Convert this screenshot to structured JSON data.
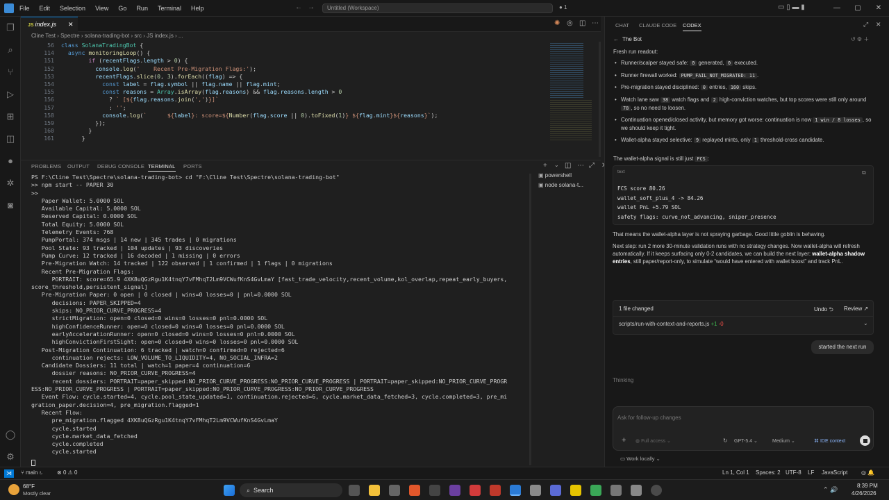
{
  "menu": [
    "File",
    "Edit",
    "Selection",
    "View",
    "Go",
    "Run",
    "Terminal",
    "Help"
  ],
  "workspace_title": "Untitled (Workspace)",
  "editor": {
    "tab": "index.js",
    "breadcrumb": "Cline Test › Spectre › solana-trading-bot › src › JS index.js › ...",
    "lines": [
      {
        "n": "56",
        "html": "<span class=\"kw\">class</span> <span class=\"cls\">SolanaTradingBot</span> {"
      },
      {
        "n": "114",
        "html": "  <span class=\"kw\">async</span> <span class=\"fn\">monitoringLoop</span>() {"
      },
      {
        "n": "151",
        "html": "        <span class=\"kw2\">if</span> (<span class=\"var\">recentFlags</span>.<span class=\"var\">length</span> &gt; <span class=\"num\">0</span>) {"
      },
      {
        "n": "152",
        "html": "          <span class=\"var\">console</span>.<span class=\"fn\">log</span>(<span class=\"str\">'    Recent Pre-Migration Flags:'</span>);"
      },
      {
        "n": "153",
        "html": "          <span class=\"var\">recentFlags</span>.<span class=\"fn\">slice</span>(<span class=\"num\">0</span>, <span class=\"num\">3</span>).<span class=\"fn\">forEach</span>((<span class=\"var\">flag</span>) =&gt; {"
      },
      {
        "n": "154",
        "html": "            <span class=\"kw\">const</span> <span class=\"var\">label</span> = <span class=\"var\">flag</span>.<span class=\"var\">symbol</span> || <span class=\"var\">flag</span>.<span class=\"var\">name</span> || <span class=\"var\">flag</span>.<span class=\"var\">mint</span>;"
      },
      {
        "n": "155",
        "html": "            <span class=\"kw\">const</span> <span class=\"var\">reasons</span> = <span class=\"cls\">Array</span>.<span class=\"fn\">isArray</span>(<span class=\"var\">flag</span>.<span class=\"var\">reasons</span>) &amp;&amp; <span class=\"var\">flag</span>.<span class=\"var\">reasons</span>.<span class=\"var\">length</span> &gt; <span class=\"num\">0</span>"
      },
      {
        "n": "156",
        "html": "              ? <span class=\"str\">` [${</span><span class=\"var\">flag</span>.<span class=\"var\">reasons</span>.<span class=\"fn\">join</span>(<span class=\"str\">','</span>)<span class=\"str\">}]`</span>"
      },
      {
        "n": "157",
        "html": "              : <span class=\"str\">''</span>;"
      },
      {
        "n": "158",
        "html": "            <span class=\"var\">console</span>.<span class=\"fn\">log</span>(<span class=\"str\">`      ${</span><span class=\"var\">label</span><span class=\"str\">}: score=${</span><span class=\"fn\">Number</span>(<span class=\"var\">flag</span>.<span class=\"var\">score</span> || <span class=\"num\">0</span>).<span class=\"fn\">toFixed</span>(<span class=\"num\">1</span>)<span class=\"str\">} ${</span><span class=\"var\">flag</span>.<span class=\"var\">mint</span><span class=\"str\">}${</span><span class=\"var\">reasons</span><span class=\"str\">}`</span>);"
      },
      {
        "n": "159",
        "html": "          });"
      },
      {
        "n": "160",
        "html": "        }"
      },
      {
        "n": "161",
        "html": "      }"
      }
    ]
  },
  "panel_tabs": [
    "PROBLEMS",
    "OUTPUT",
    "DEBUG CONSOLE",
    "TERMINAL",
    "PORTS"
  ],
  "terminal_sessions": [
    "powershell",
    "node solana-t..."
  ],
  "terminal_text": "PS F:\\Cline Test\\Spectre\\solana-trading-bot> cd \"F:\\Cline Test\\Spectre\\solana-trading-bot\"\n>> npm start -- PAPER 30\n>>\n   Paper Wallet: 5.0000 SOL\n   Available Capital: 5.0000 SOL\n   Reserved Capital: 0.0000 SOL\n   Total Equity: 5.0000 SOL\n   Telemetry Events: 768\n   PumpPortal: 374 msgs | 14 new | 345 trades | 0 migrations\n   Pool State: 93 tracked | 104 updates | 93 discoveries\n   Pump Curve: 12 tracked | 16 decoded | 1 missing | 0 errors\n   Pre-Migration Watch: 14 tracked | 122 observed | 1 confirmed | 1 flags | 0 migrations\n   Recent Pre-Migration Flags:\n      PORTRAIT: score=65.9 4XK8uQGzRgu1K4tnqY7vFMhqT2Lm9VCWufKnS4GvLmaY [fast_trade_velocity,recent_volume,kol_overlap,repeat_early_buyers,\nscore_threshold,persistent_signal]\n   Pre-Migration Paper: 0 open | 0 closed | wins=0 losses=0 | pnl=0.0000 SOL\n      decisions: PAPER_SKIPPED=4\n      skips: NO_PRIOR_CURVE_PROGRESS=4\n      strictMigration: open=0 closed=0 wins=0 losses=0 pnl=0.0000 SOL\n      highConfidenceRunner: open=0 closed=0 wins=0 losses=0 pnl=0.0000 SOL\n      earlyAccelerationRunner: open=0 closed=0 wins=0 losses=0 pnl=0.0000 SOL\n      highConvictionFirstSight: open=0 closed=0 wins=0 losses=0 pnl=0.0000 SOL\n   Post-Migration Continuation: 6 tracked | watch=0 confirmed=0 rejected=6\n      continuation rejects: LOW_VOLUME_TO_LIQUIDITY=4, NO_SOCIAL_INFRA=2\n   Candidate Dossiers: 11 total | watch=1 paper=4 continuation=6\n      dossier reasons: NO_PRIOR_CURVE_PROGRESS=4\n      recent dossiers: PORTRAIT=paper_skipped:NO_PRIOR_CURVE_PROGRESS:NO_PRIOR_CURVE_PROGRESS | PORTRAIT=paper_skipped:NO_PRIOR_CURVE_PROGR\nESS:NO_PRIOR_CURVE_PROGRESS | PORTRAIT=paper_skipped:NO_PRIOR_CURVE_PROGRESS:NO_PRIOR_CURVE_PROGRESS\n   Event Flow: cycle.started=4, cycle.pool_state_updated=1, continuation.rejected=6, cycle.market_data_fetched=3, cycle.completed=3, pre_mi\ngration_paper.decision=4, pre_migration.flagged=1\n   Recent Flow:\n      pre_migration.flagged 4XK8uQGzRgu1K4tnqY7vFMhqT2Lm9VCWufKnS4GvLmaY\n      cycle.started\n      cycle.market_data_fetched\n      cycle.completed\n      cycle.started",
  "right": {
    "tabs": [
      "CHAT",
      "CLAUDE CODE",
      "CODEX"
    ],
    "thread_title": "The Bot",
    "heading": "Fresh run readout:",
    "bullets": [
      "Runner/scalper stayed safe: [0] generated, [0] executed.",
      "Runner firewall worked: [PUMP_FAIL_NOT_MIGRATED: 11].",
      "Pre-migration stayed disciplined: [0] entries, [160] skips.",
      "Watch lane saw [38] watch flags and [2] high-conviction watches, but top scores were still only around [78], so no need to loosen.",
      "Continuation opened/closed activity, but memory got worse: continuation is now [1 win / 8 losses], so we should keep it tight.",
      "Wallet-alpha stayed selective: [9] replayed mints, only [1] threshold-cross candidate."
    ],
    "signal_line": "The wallet-alpha signal is still just [FCS]:",
    "codeblock_lang": "text",
    "codeblock_lines": [
      "FCS score 80.26",
      "wallet_soft_plus_4 -> 84.26",
      "wallet PnL +5.79 SOL",
      "safety flags: curve_not_advancing, sniper_presence"
    ],
    "para1": "That means the wallet-alpha layer is not spraying garbage. Good little goblin is behaving.",
    "para2_a": "Next step: run 2 more 30-minute validation runs with no strategy changes. Now wallet-alpha will refresh automatically. If it keeps surfacing only 0-2 candidates, we can build the next layer: ",
    "para2_b": "wallet-alpha shadow entries",
    "para2_c": ", still paper/report-only, to simulate “would have entered with wallet boost” and track PnL.",
    "files_changed": "1 file changed",
    "undo": "Undo ⮌",
    "review": "Review ↗",
    "file_path": "scripts/run-with-context-and-reports.js",
    "file_diff_add": "+1",
    "file_diff_del": "-0",
    "user_msg": "started the next run",
    "thinking": "Thinking",
    "composer_placeholder": "Ask for follow-up changes",
    "access": "Full access",
    "model": "GPT-5.4",
    "effort": "Medium",
    "ide_context": "IDE context",
    "work_mode": "Work locally"
  },
  "status": {
    "branch": "main",
    "errors": "0",
    "warnings": "0",
    "position": "Ln 1, Col 1",
    "spaces": "Spaces: 2",
    "encoding": "UTF-8",
    "eol": "LF",
    "language": "JavaScript"
  },
  "taskbar": {
    "weather_temp": "68°F",
    "weather_desc": "Mostly clear",
    "search": "Search",
    "time": "8:39 PM",
    "date": "4/26/2026"
  }
}
